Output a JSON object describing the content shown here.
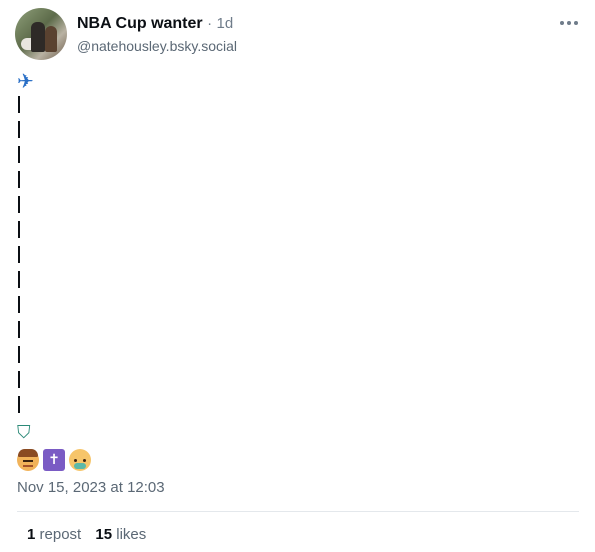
{
  "author": {
    "display_name": "NBA Cup wanter",
    "separator": "·",
    "age": "1d",
    "handle": "@natehousley.bsky.social"
  },
  "menu": {
    "icon": "more-horizontal-icon"
  },
  "post": {
    "lines": [
      {
        "type": "icon",
        "name": "airplane-emoji"
      },
      {
        "type": "icon",
        "name": "vertical-line-dashes",
        "count": 13
      },
      {
        "type": "icon",
        "name": "parachute-emoji"
      },
      {
        "type": "icon_row",
        "names": [
          "man-face-emoji",
          "latin-cross-emoji",
          "baby-face-emoji"
        ]
      }
    ],
    "cross_glyph": "✝"
  },
  "timestamp": "Nov 15, 2023 at 12:03",
  "stats": {
    "reposts_count": "1",
    "reposts_label": "repost",
    "likes_count": "15",
    "likes_label": "likes"
  },
  "colors": {
    "text": "#0b0f14",
    "muted": "#5b6875",
    "divider": "#e4e8ec"
  }
}
